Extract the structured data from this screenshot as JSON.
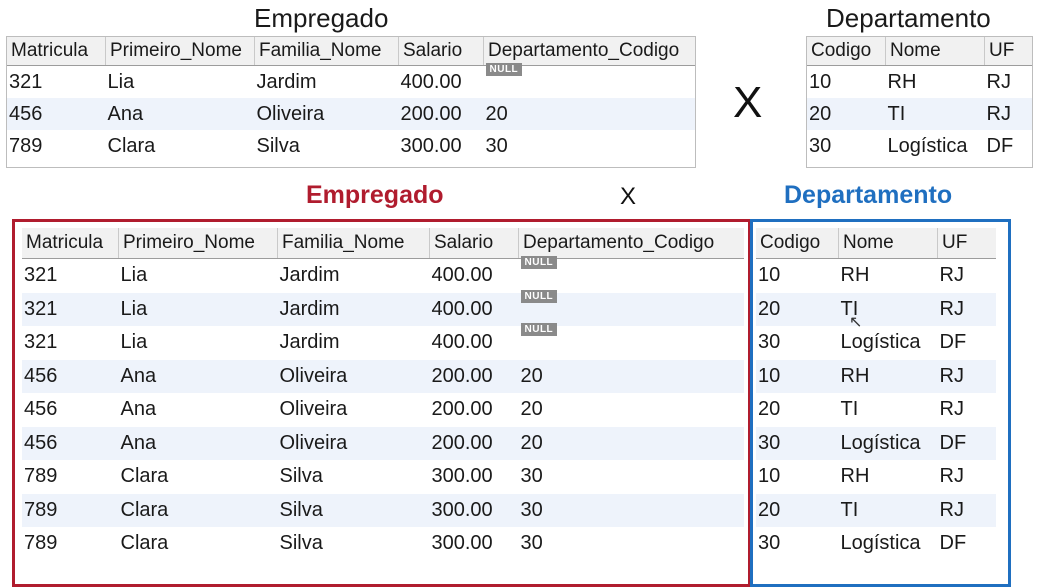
{
  "top": {
    "empregado_title": "Empregado",
    "departamento_title": "Departamento",
    "operator": "X",
    "empregado": {
      "columns": [
        "Matricula",
        "Primeiro_Nome",
        "Familia_Nome",
        "Salario",
        "Departamento_Codigo"
      ],
      "rows": [
        [
          "321",
          "Lia",
          "Jardim",
          "400.00",
          "NULL"
        ],
        [
          "456",
          "Ana",
          "Oliveira",
          "200.00",
          "20"
        ],
        [
          "789",
          "Clara",
          "Silva",
          "300.00",
          "30"
        ]
      ]
    },
    "departamento": {
      "columns": [
        "Codigo",
        "Nome",
        "UF"
      ],
      "rows": [
        [
          "10",
          "RH",
          "RJ"
        ],
        [
          "20",
          "TI",
          "RJ"
        ],
        [
          "30",
          "Logística",
          "DF"
        ]
      ]
    }
  },
  "bottom": {
    "empregado_title": "Empregado",
    "operator": "X",
    "departamento_title": "Departamento",
    "colors": {
      "empregado": "#b01c2e",
      "departamento": "#1f6fc0"
    },
    "empregado_columns": [
      "Matricula",
      "Primeiro_Nome",
      "Familia_Nome",
      "Salario",
      "Departamento_Codigo"
    ],
    "departamento_columns": [
      "Codigo",
      "Nome",
      "UF"
    ],
    "empregado_rows": [
      [
        "321",
        "Lia",
        "Jardim",
        "400.00",
        "NULL"
      ],
      [
        "321",
        "Lia",
        "Jardim",
        "400.00",
        "NULL"
      ],
      [
        "321",
        "Lia",
        "Jardim",
        "400.00",
        "NULL"
      ],
      [
        "456",
        "Ana",
        "Oliveira",
        "200.00",
        "20"
      ],
      [
        "456",
        "Ana",
        "Oliveira",
        "200.00",
        "20"
      ],
      [
        "456",
        "Ana",
        "Oliveira",
        "200.00",
        "20"
      ],
      [
        "789",
        "Clara",
        "Silva",
        "300.00",
        "30"
      ],
      [
        "789",
        "Clara",
        "Silva",
        "300.00",
        "30"
      ],
      [
        "789",
        "Clara",
        "Silva",
        "300.00",
        "30"
      ]
    ],
    "departamento_rows": [
      [
        "10",
        "RH",
        "RJ"
      ],
      [
        "20",
        "TI",
        "RJ"
      ],
      [
        "30",
        "Logística",
        "DF"
      ],
      [
        "10",
        "RH",
        "RJ"
      ],
      [
        "20",
        "TI",
        "RJ"
      ],
      [
        "30",
        "Logística",
        "DF"
      ],
      [
        "10",
        "RH",
        "RJ"
      ],
      [
        "20",
        "TI",
        "RJ"
      ],
      [
        "30",
        "Logística",
        "DF"
      ]
    ]
  }
}
